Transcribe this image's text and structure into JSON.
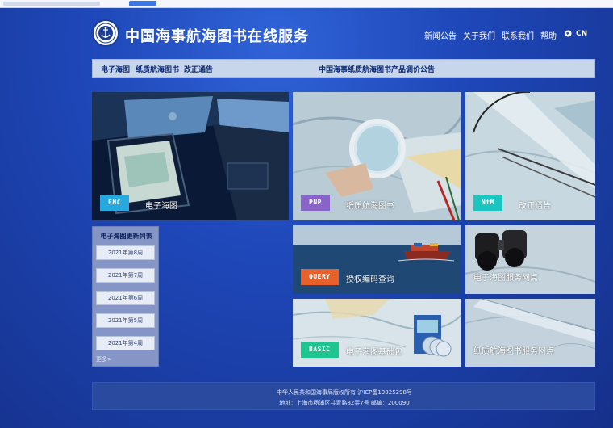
{
  "site": {
    "title": "中国海事航海图书在线服务"
  },
  "topnav": {
    "items": [
      "新闻公告",
      "关于我们",
      "联系我们",
      "帮助"
    ],
    "lang": "CN"
  },
  "subnav": {
    "items": [
      "电子海图",
      "纸质航海图书",
      "改正通告"
    ],
    "announcement": "中国海事纸质航海图书产品调价公告"
  },
  "tiles": [
    {
      "tag": "ENC",
      "label": "电子海图",
      "tag_color": "#29a8e0"
    },
    {
      "tag": "PNP",
      "label": "纸质航海图书",
      "tag_color": "#8a63c9"
    },
    {
      "tag": "NtM",
      "label": "改正通告",
      "tag_color": "#1bc6c0"
    },
    {
      "tag": "QUERY",
      "label": "授权编码查询",
      "tag_color": "#e8602a"
    },
    {
      "tag": "",
      "label": "电子海图服务网点",
      "tag_color": ""
    },
    {
      "tag": "BASIC",
      "label": "电子海图基础包",
      "tag_color": "#1ec58e"
    },
    {
      "tag": "",
      "label": "纸质航海图书服务网点",
      "tag_color": ""
    }
  ],
  "update_panel": {
    "title": "电子海图更新列表",
    "items": [
      "2021年第8周",
      "2021年第7周",
      "2021年第6周",
      "2021年第5周",
      "2021年第4周"
    ],
    "more": "更多>"
  },
  "footer": {
    "line1": "中华人民共和国海事局版权所有 沪ICP备19025298号",
    "line2": "地址：上海市杨浦区共青路82弄7号 邮编：200090"
  },
  "colors": {
    "background": "#1e47b8",
    "subnav_bg": "#c8d6ec",
    "panel_bg": "#8596c6",
    "footer_bg": "#2a4aa0"
  }
}
